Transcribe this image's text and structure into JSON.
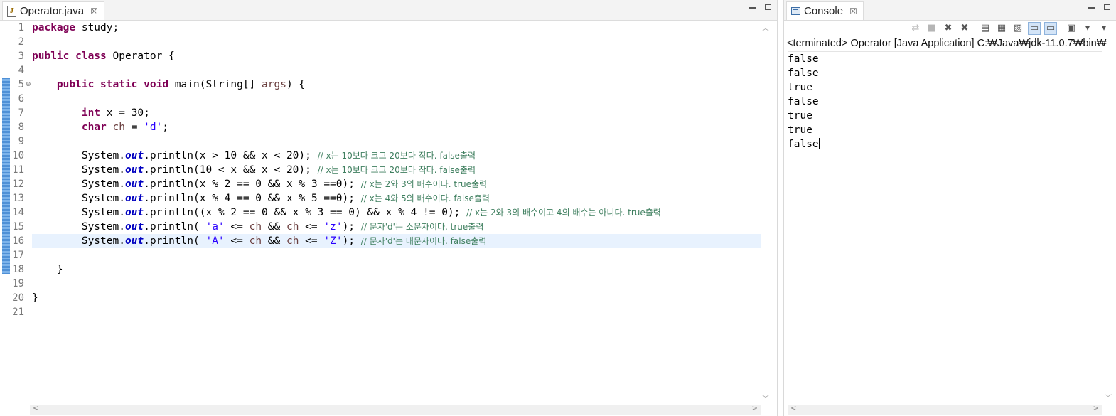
{
  "editor": {
    "tab_label": "Operator.java",
    "tab_close": "☒",
    "line_numbers": [
      "1",
      "2",
      "3",
      "4",
      "5",
      "6",
      "7",
      "8",
      "9",
      "10",
      "11",
      "12",
      "13",
      "14",
      "15",
      "16",
      "17",
      "18",
      "19",
      "20",
      "21"
    ],
    "code": {
      "l1_kw": "package",
      "l1_rest": " study;",
      "l3_kw": "public class",
      "l3_rest": " Operator {",
      "l5_kw": "public static void",
      "l5_mid": " main(String[] ",
      "l5_var": "args",
      "l5_end": ") {",
      "l7_kw": "int",
      "l7_rest": " x = 30;",
      "l8_kw": "char",
      "l8_var": " ch",
      "l8_mid": " = ",
      "l8_str": "'d'",
      "l8_end": ";",
      "sys": "System.",
      "out": "out",
      "println": ".println(",
      "l10_args": "x > 10 && x < 20); ",
      "l10_cm": "// x는 10보다 크고 20보다 작다. false출력",
      "l11_args": "10 < x && x < 20); ",
      "l11_cm": "// x는 10보다 크고 20보다 작다. false출력",
      "l12_args": "x % 2 == 0 && x % 3 ==0); ",
      "l12_cm": "// x는 2와 3의 배수이다. true출력",
      "l13_args": "x % 4 == 0 && x % 5 ==0); ",
      "l13_cm": "// x는 4와 5의 배수이다. false출력",
      "l14_args": "(x % 2 == 0 && x % 3 == 0) && x % 4 != 0); ",
      "l14_cm": "// x는 2와 3의 배수이고 4의 배수는 아니다. true출력",
      "l15_pre": " ",
      "l15_s1": "'a'",
      "l15_mid1": " <= ",
      "l15_v1": "ch",
      "l15_mid2": " && ",
      "l15_v2": "ch",
      "l15_mid3": " <= ",
      "l15_s2": "'z'",
      "l15_end": "); ",
      "l15_cm": "// 문자'd'는 소문자이다. true출력",
      "l16_pre": " ",
      "l16_s1": "'A'",
      "l16_mid1": " <= ",
      "l16_v1": "ch",
      "l16_mid2": " && ",
      "l16_v2": "ch",
      "l16_mid3": " <= ",
      "l16_s2": "'Z'",
      "l16_end": "); ",
      "l16_cm": "// 문자'd'는 대문자이다. false출력",
      "l18": "}",
      "l20": "}"
    }
  },
  "console": {
    "tab_label": "Console",
    "tab_close": "☒",
    "status": "<terminated> Operator [Java Application] C:₩Java₩jdk-11.0.7₩bin₩",
    "output": [
      "false",
      "false",
      "true",
      "false",
      "true",
      "true",
      "false"
    ]
  },
  "colors": {
    "keyword": "#7f0055",
    "string": "#2a00ff",
    "comment": "#3f7f5f",
    "static_field": "#0000c0",
    "local_var": "#6a3e3e",
    "current_line": "#e8f2fe",
    "change_bar": "#6aa5e0"
  }
}
